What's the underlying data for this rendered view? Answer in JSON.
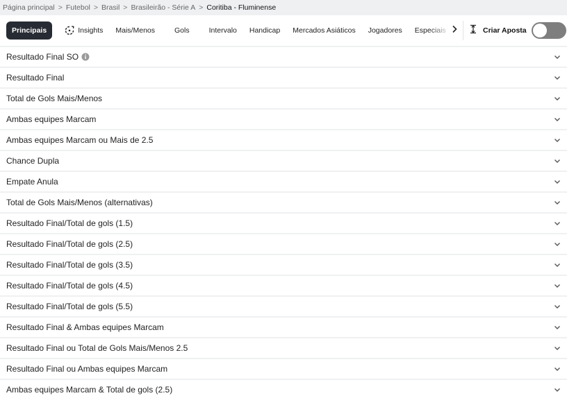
{
  "breadcrumb": [
    {
      "label": "Página principal"
    },
    {
      "label": "Futebol"
    },
    {
      "label": "Brasil"
    },
    {
      "label": "Brasileirão - Série A"
    },
    {
      "label": "Coritiba - Fluminense"
    }
  ],
  "tabs": [
    {
      "label": "Principais",
      "active": true
    },
    {
      "label": "Insights",
      "icon": "insights-icon"
    },
    {
      "label": "Mais/Menos"
    },
    {
      "label": "Gols"
    },
    {
      "label": "Intervalo"
    },
    {
      "label": "Handicap"
    },
    {
      "label": "Mercados Asiáticos"
    },
    {
      "label": "Jogadores"
    },
    {
      "label": "Especiais"
    }
  ],
  "bet_builder": {
    "label": "Criar Aposta",
    "icon": "bet-builder-icon",
    "enabled": false
  },
  "markets": [
    {
      "title": "Resultado Final SO",
      "info": true
    },
    {
      "title": "Resultado Final"
    },
    {
      "title": "Total de Gols Mais/Menos"
    },
    {
      "title": "Ambas equipes Marcam"
    },
    {
      "title": "Ambas equipes Marcam ou Mais de 2.5"
    },
    {
      "title": "Chance Dupla"
    },
    {
      "title": "Empate Anula"
    },
    {
      "title": "Total de Gols Mais/Menos (alternativas)"
    },
    {
      "title": "Resultado Final/Total de gols (1.5)"
    },
    {
      "title": "Resultado Final/Total de gols (2.5)"
    },
    {
      "title": "Resultado Final/Total de gols (3.5)"
    },
    {
      "title": "Resultado Final/Total de gols (4.5)"
    },
    {
      "title": "Resultado Final/Total de gols (5.5)"
    },
    {
      "title": "Resultado Final & Ambas equipes Marcam"
    },
    {
      "title": "Resultado Final ou Total de Gols Mais/Menos 2.5"
    },
    {
      "title": "Resultado Final ou Ambas equipes Marcam"
    },
    {
      "title": "Ambas equipes Marcam & Total de gols (2.5)"
    }
  ],
  "colors": {
    "active_tab_bg": "#272b33",
    "toggle_off": "#7e7e7e",
    "page_bg": "#eef0f2"
  }
}
